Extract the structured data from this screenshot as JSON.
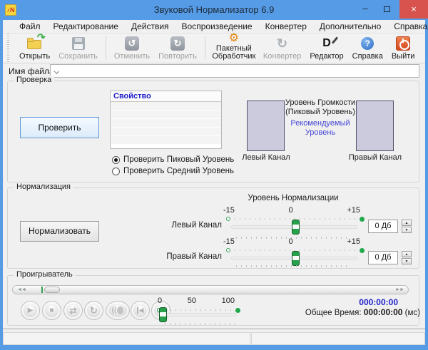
{
  "window": {
    "title": "Звуковой Нормализатор 6.9",
    "app_icon_glyph": "♪N",
    "minimize_glyph": "–",
    "close_glyph": "×"
  },
  "menu": {
    "items": [
      "Файл",
      "Редактирование",
      "Действия",
      "Воспроизведение",
      "Конвертер",
      "Дополнительно",
      "Справка"
    ]
  },
  "toolbar": {
    "buttons": [
      {
        "label": "Открыть",
        "icon": "open-folder-icon",
        "enabled": true
      },
      {
        "label": "Сохранить",
        "icon": "save-icon",
        "enabled": false
      },
      {
        "label": "Отменить",
        "icon": "undo-icon",
        "enabled": false
      },
      {
        "label": "Повторить",
        "icon": "redo-icon",
        "enabled": false
      },
      {
        "label": "Пакетный Обработчик",
        "icon": "batch-gear-icon",
        "enabled": true
      },
      {
        "label": "Конвертер",
        "icon": "converter-icon",
        "enabled": false
      },
      {
        "label": "Редактор",
        "icon": "editor-icon",
        "enabled": true
      },
      {
        "label": "Справка",
        "icon": "help-icon",
        "enabled": true
      },
      {
        "label": "Выйти",
        "icon": "exit-icon",
        "enabled": true
      }
    ]
  },
  "file_row": {
    "label": "Имя файла:",
    "value": ""
  },
  "check": {
    "legend": "Проверка",
    "button": "Проверить",
    "table_header": "Свойство",
    "radio_peak": "Проверить Пиковый Уровень",
    "radio_avg": "Проверить Средний Уровень",
    "meter_caption_line1": "Уровень Громкости",
    "meter_caption_line2": "(Пиковый Уровень)",
    "recommended_line1": "Рекомендуемый",
    "recommended_line2": "Уровень",
    "left_label": "Левый Канал",
    "right_label": "Правый Канал"
  },
  "normalize": {
    "legend": "Нормализация",
    "button": "Нормализовать",
    "title": "Уровень Нормализации",
    "scale_min": "-15",
    "scale_mid": "0",
    "scale_max": "+15",
    "left_label": "Левый Канал",
    "right_label": "Правый Канал",
    "left_value": "0 Дб",
    "right_value": "0 Дб",
    "spin_up_glyph": "▲",
    "spin_down_glyph": "▼"
  },
  "player": {
    "legend": "Проигрыватель",
    "seek_back_glyph": "◄◄",
    "seek_fwd_glyph": "►►",
    "buttons": [
      "play",
      "stop",
      "shuffle",
      "repeat",
      "volume",
      "previous",
      "next"
    ],
    "volume_scale": [
      "0",
      "50",
      "100"
    ],
    "current_time": "000:00:00",
    "total_label": "Общее Время:",
    "total_value": "000:00:00",
    "total_unit": "(мс)"
  },
  "colors": {
    "titlebar_blue": "#569be6",
    "close_red": "#d9534e",
    "accent_green": "#21a84c",
    "recommended_link": "#4646d6",
    "time_blue": "#2121cc",
    "header_blue": "#2121cc"
  }
}
